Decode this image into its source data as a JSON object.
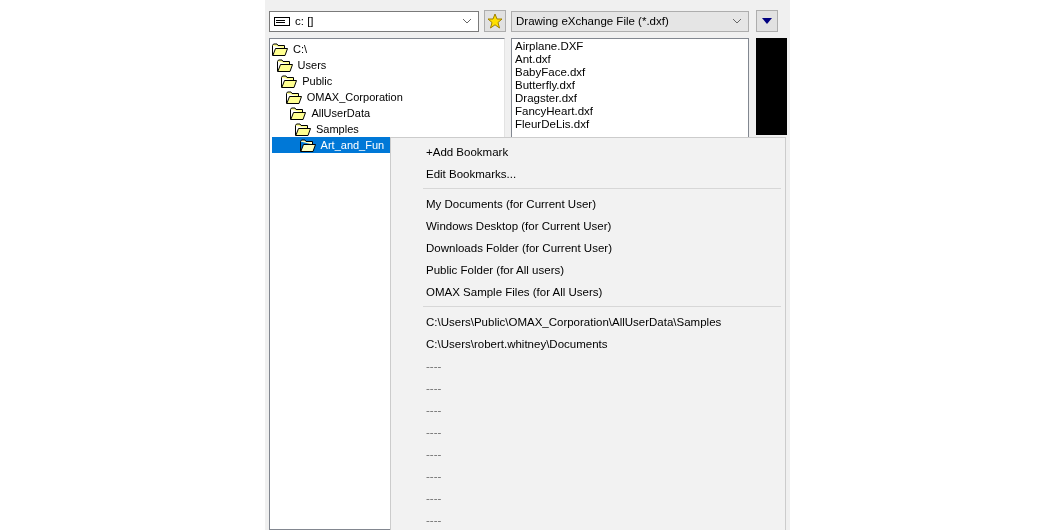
{
  "drive_combo": {
    "value": "c: []"
  },
  "file_type_combo": {
    "value": "Drawing eXchange File (*.dxf)"
  },
  "folder_tree": [
    {
      "label": "C:\\",
      "selected": false,
      "children": [
        {
          "label": "Users",
          "selected": false,
          "children": [
            {
              "label": "Public",
              "selected": false,
              "children": [
                {
                  "label": "OMAX_Corporation",
                  "selected": false,
                  "children": [
                    {
                      "label": "AllUserData",
                      "selected": false,
                      "children": [
                        {
                          "label": "Samples",
                          "selected": false,
                          "children": [
                            {
                              "label": "Art_and_Fun",
                              "selected": true
                            }
                          ]
                        }
                      ]
                    }
                  ]
                }
              ]
            }
          ]
        }
      ]
    }
  ],
  "files": [
    "Airplane.DXF",
    "Ant.dxf",
    "BabyFace.dxf",
    "Butterfly.dxf",
    "Dragster.dxf",
    "FancyHeart.dxf",
    "FleurDeLis.dxf"
  ],
  "bookmark_menu": [
    {
      "kind": "item",
      "label": "+Add Bookmark",
      "disabled": false
    },
    {
      "kind": "item",
      "label": "Edit Bookmarks...",
      "disabled": false
    },
    {
      "kind": "separator"
    },
    {
      "kind": "item",
      "label": "My Documents (for Current User)",
      "disabled": false
    },
    {
      "kind": "item",
      "label": "Windows Desktop (for Current User)",
      "disabled": false
    },
    {
      "kind": "item",
      "label": "Downloads Folder (for Current User)",
      "disabled": false
    },
    {
      "kind": "item",
      "label": "Public Folder (for All users)",
      "disabled": false
    },
    {
      "kind": "item",
      "label": "OMAX Sample Files (for All Users)",
      "disabled": false
    },
    {
      "kind": "separator"
    },
    {
      "kind": "item",
      "label": "C:\\Users\\Public\\OMAX_Corporation\\AllUserData\\Samples",
      "disabled": false
    },
    {
      "kind": "item",
      "label": "C:\\Users\\robert.whitney\\Documents",
      "disabled": false
    },
    {
      "kind": "item",
      "label": "----",
      "disabled": true
    },
    {
      "kind": "item",
      "label": "----",
      "disabled": true
    },
    {
      "kind": "item",
      "label": "----",
      "disabled": true
    },
    {
      "kind": "item",
      "label": "----",
      "disabled": true
    },
    {
      "kind": "item",
      "label": "----",
      "disabled": true
    },
    {
      "kind": "item",
      "label": "----",
      "disabled": true
    },
    {
      "kind": "item",
      "label": "----",
      "disabled": true
    },
    {
      "kind": "item",
      "label": "----",
      "disabled": true
    }
  ]
}
